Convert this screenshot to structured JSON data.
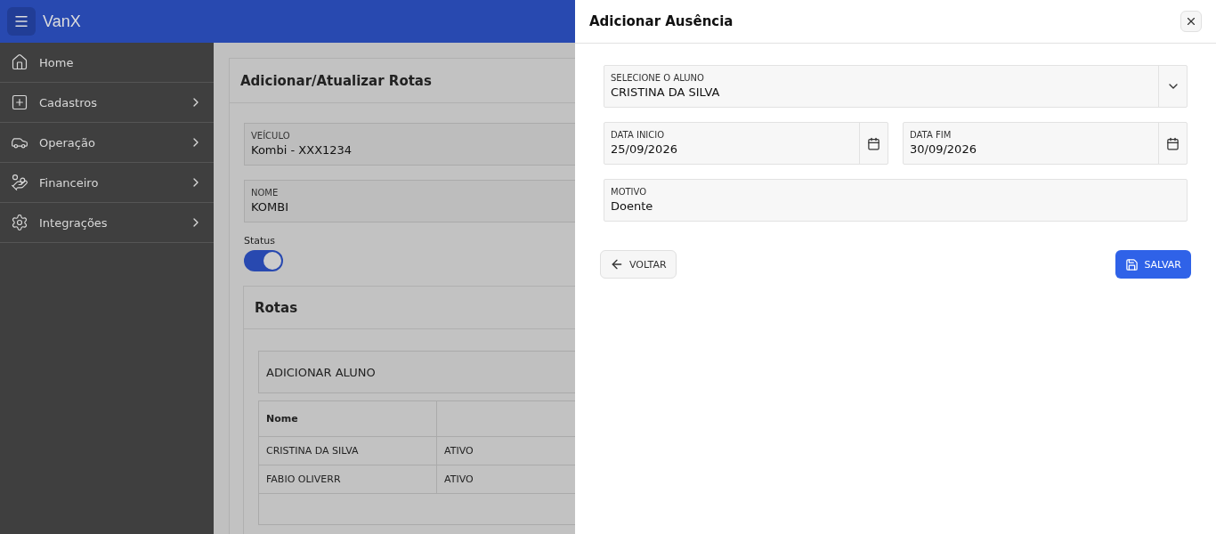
{
  "app": {
    "title": "VanX"
  },
  "sidebar": {
    "items": [
      {
        "label": "Home",
        "has_submenu": false
      },
      {
        "label": "Cadastros",
        "has_submenu": true
      },
      {
        "label": "Operação",
        "has_submenu": true
      },
      {
        "label": "Financeiro",
        "has_submenu": true
      },
      {
        "label": "Integrações",
        "has_submenu": true
      }
    ]
  },
  "route_form": {
    "title": "Adicionar/Atualizar Rotas",
    "fields": [
      {
        "label": "VEÍCULO",
        "value": "Kombi - XXX1234"
      },
      {
        "label": "NOME",
        "value": "KOMBI"
      }
    ],
    "status": {
      "label": "Status",
      "on": true
    },
    "routes": {
      "title": "Rotas",
      "add_button": "ADICIONAR ALUNO",
      "columns": [
        "Nome"
      ],
      "rows": [
        {
          "name": "CRISTINA DA SILVA",
          "column_2": "ATIVO"
        },
        {
          "name": "FABIO OLIVERR",
          "column_2": "ATIVO"
        }
      ]
    }
  },
  "drawer": {
    "title": "Adicionar Ausência",
    "student": {
      "label": "SELECIONE O ALUNO",
      "value": "CRISTINA DA SILVA"
    },
    "start_date": {
      "label": "DATA INICIO",
      "value": "25/09/2026"
    },
    "end_date": {
      "label": "DATA FIM",
      "value": "30/09/2026"
    },
    "reason": {
      "label": "MOTIVO",
      "value": "Doente"
    },
    "back_button": "VOLTAR",
    "save_button": "SALVAR"
  }
}
